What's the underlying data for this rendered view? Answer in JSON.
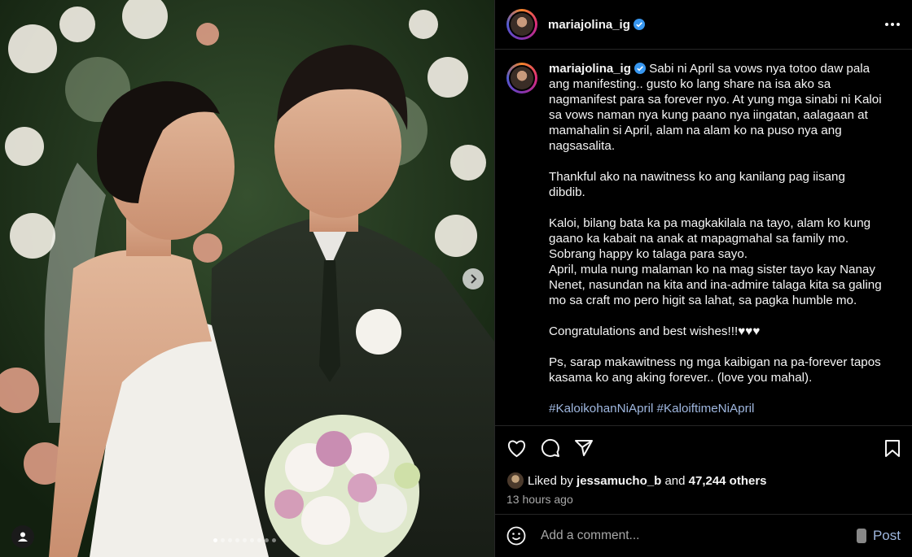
{
  "post": {
    "username": "mariajolina_ig",
    "more_icon": "more-horizontal-icon",
    "verified_icon": "verified-badge-icon"
  },
  "caption": {
    "username": "mariajolina_ig",
    "paragraphs": [
      "Sabi ni April sa vows nya totoo daw pala ang manifesting.. gusto ko lang share na isa ako sa nagmanifest para sa forever nyo. At yung mga sinabi ni Kaloi sa vows naman nya kung paano nya iingatan, aalagaan at mamahalin si April, alam na alam ko na puso nya ang nagsasalita.",
      "Thankful ako na nawitness ko ang kanilang pag iisang dibdib.",
      "Kaloi, bilang bata ka pa magkakilala na tayo, alam ko kung gaano ka kabait na anak at mapagmahal sa family mo. Sobrang happy ko talaga para sayo.",
      "April, mula nung malaman ko na mag sister tayo kay Nanay Nenet, nasundan na kita and ina-admire talaga kita sa galing mo sa craft mo pero higit sa lahat, sa pagka humble mo.",
      "Congratulations and best wishes!!!♥♥♥",
      "Ps, sarap makawitness ng mga kaibigan na pa-forever tapos kasama ko ang aking forever.. (love you mahal).",
      "#KaloikohanNiApril #KaloiftimeNiApril"
    ]
  },
  "actions": {
    "like_icon": "heart-icon",
    "comment_icon": "comment-icon",
    "share_icon": "paper-plane-icon",
    "save_icon": "bookmark-icon"
  },
  "likes": {
    "prefix": "Liked by",
    "user": "jessamucho_b",
    "joiner": "and",
    "others": "47,244 others"
  },
  "timestamp": "13 hours ago",
  "comment_box": {
    "placeholder": "Add a comment...",
    "post_label": "Post",
    "emoji_icon": "smiley-icon"
  },
  "carousel": {
    "slide_count": 9,
    "current": 1
  },
  "colors": {
    "background": "#000000",
    "border": "#262626",
    "link": "#9fb7df",
    "muted": "#a8a8a8"
  }
}
